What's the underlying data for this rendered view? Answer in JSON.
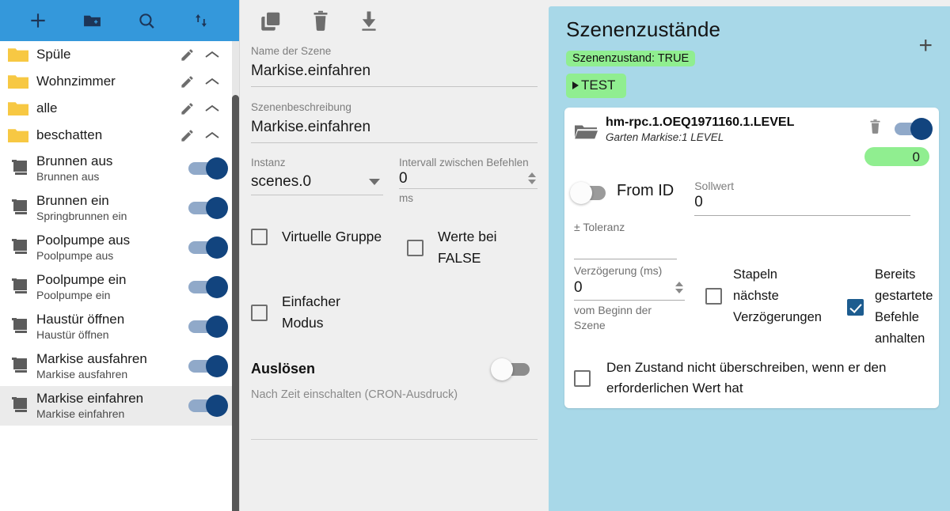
{
  "sidebar": {
    "toolbar": [
      {
        "name": "add-scene-button",
        "icon": "plus-icon",
        "label": "+"
      },
      {
        "name": "add-folder-button",
        "icon": "folder-add-icon",
        "label": ""
      },
      {
        "name": "search-button",
        "icon": "search-icon",
        "label": ""
      },
      {
        "name": "sort-button",
        "icon": "sort-icon",
        "label": ""
      }
    ],
    "folders": [
      {
        "label": "Spüle"
      },
      {
        "label": "Wohnzimmer"
      },
      {
        "label": "alle"
      },
      {
        "label": "beschatten"
      }
    ],
    "scenes": [
      {
        "title": "Brunnen aus",
        "subtitle": "Brunnen aus",
        "enabled": true,
        "selected": false
      },
      {
        "title": "Brunnen ein",
        "subtitle": "Springbrunnen ein",
        "enabled": true,
        "selected": false
      },
      {
        "title": "Poolpumpe aus",
        "subtitle": "Poolpumpe aus",
        "enabled": true,
        "selected": false
      },
      {
        "title": "Poolpumpe ein",
        "subtitle": "Poolpumpe ein",
        "enabled": true,
        "selected": false
      },
      {
        "title": "Haustür öffnen",
        "subtitle": "Haustür öffnen",
        "enabled": true,
        "selected": false
      },
      {
        "title": "Markise ausfahren",
        "subtitle": "Markise ausfahren",
        "enabled": true,
        "selected": false
      },
      {
        "title": "Markise einfahren",
        "subtitle": "Markise einfahren",
        "enabled": true,
        "selected": true
      }
    ]
  },
  "editor": {
    "toolbar": [
      {
        "name": "copy-scene-button",
        "icon": "copy-icon"
      },
      {
        "name": "delete-scene-button",
        "icon": "trash-icon"
      },
      {
        "name": "export-scene-button",
        "icon": "download-icon"
      }
    ],
    "name_label": "Name der Szene",
    "name_value": "Markise.einfahren",
    "desc_label": "Szenenbeschreibung",
    "desc_value": "Markise.einfahren",
    "instance_label": "Instanz",
    "instance_value": "scenes.0",
    "interval_label": "Intervall zwischen Befehlen",
    "interval_value": "0",
    "interval_suffix": "ms",
    "virtual_group_label": "Virtuelle Gruppe",
    "virtual_group_checked": false,
    "false_values_label": "Werte bei FALSE",
    "false_values_checked": false,
    "simple_mode_label": "Einfacher Modus",
    "simple_mode_checked": false,
    "trigger_title": "Auslösen",
    "trigger_enabled": false,
    "cron_hint": "Nach Zeit einschalten (CRON-Ausdruck)"
  },
  "states_panel": {
    "title": "Szenenzustände",
    "add_label": "+",
    "state_badge": "Szenenzustand: TRUE",
    "test_label": "TEST",
    "card": {
      "id": "hm-rpc.1.OEQ1971160.1.LEVEL",
      "subtitle": "Garten Markise:1 LEVEL",
      "delete_icon": "trash-icon",
      "enabled": true,
      "current_value": "0",
      "from_id_label": "From ID",
      "from_id_enabled": false,
      "setpoint_label": "Sollwert",
      "setpoint_value": "0",
      "tolerance_label": "± Toleranz",
      "tolerance_value": "",
      "delay_label": "Verzögerung (ms)",
      "delay_value": "0",
      "delay_hint": "vom Beginn der Szene",
      "stack_delays_label": "Stapeln nächste Verzögerungen",
      "stack_delays_checked": false,
      "stop_started_label": "Bereits gestartete Befehle anhalten",
      "stop_started_checked": true,
      "no_overwrite_label": "Den Zustand nicht überschreiben, wenn er den erforderlichen Wert hat",
      "no_overwrite_checked": false
    }
  },
  "colors": {
    "toolbar_blue": "#3498db",
    "panel_blue": "#a8d8e8",
    "accent_green": "#90ee90",
    "switch_on": "#12447e",
    "folder_yellow": "#f7c843"
  }
}
